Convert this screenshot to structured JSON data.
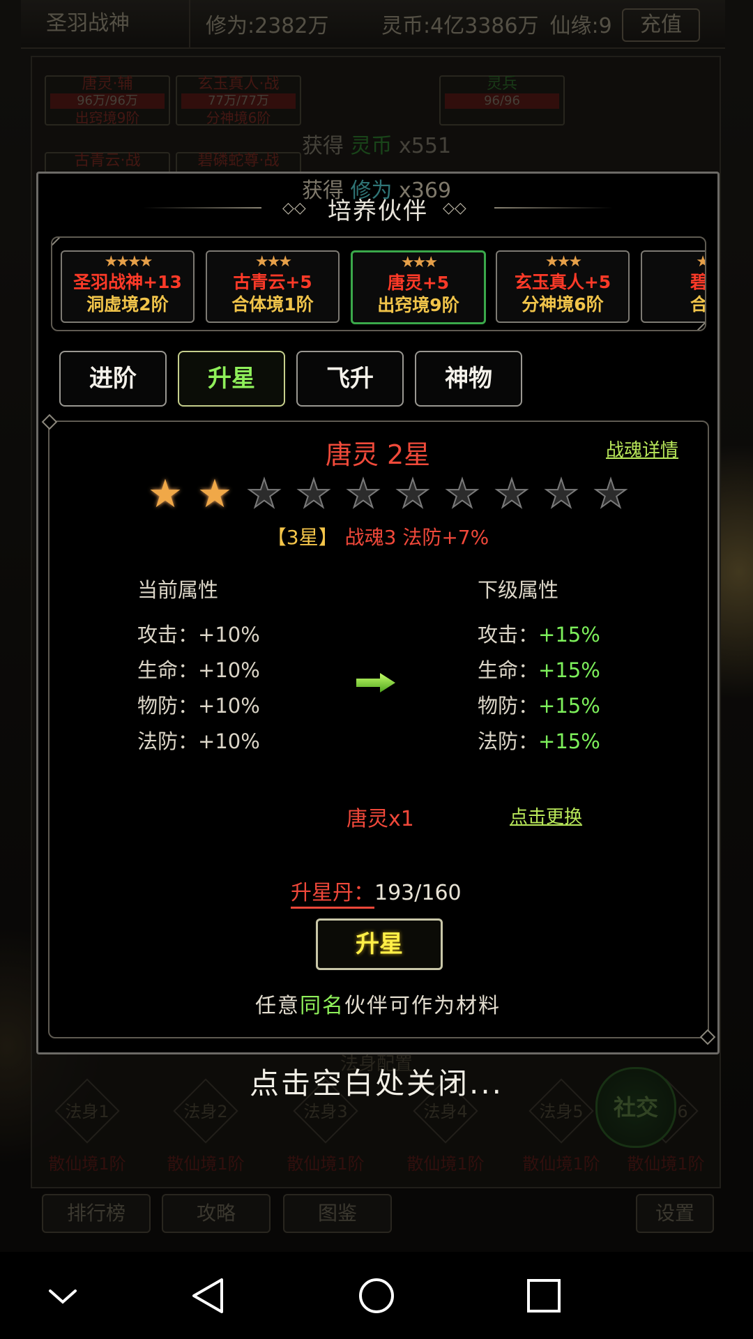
{
  "topbar": {
    "player_name": "圣羽战神",
    "cultivation": "修为:2382万",
    "spirit_coin": "灵币:4亿3386万",
    "fate": "仙缘:9",
    "recharge": "充值"
  },
  "background": {
    "cells": [
      {
        "title": "唐灵·辅",
        "hp": "96万/96万",
        "realm": "出窍境9阶"
      },
      {
        "title": "玄玉真人·战",
        "hp": "77万/77万",
        "realm": "分神境6阶"
      },
      {
        "title": "灵兵",
        "hp": "96/96",
        "realm": ""
      },
      {
        "title": "古青云·战",
        "hp": "",
        "realm": ""
      },
      {
        "title": "碧磷蛇尊·战",
        "hp": "",
        "realm": ""
      }
    ],
    "gain1": {
      "prefix": "获得 ",
      "item": "灵币",
      "qty": " x551"
    },
    "gain2": {
      "prefix": "获得 ",
      "item": "修为",
      "qty": " x369"
    },
    "fashen_title": "法身配置",
    "fashen": [
      {
        "name": "法身1",
        "realm": "散仙境1阶"
      },
      {
        "name": "法身2",
        "realm": "散仙境1阶"
      },
      {
        "name": "法身3",
        "realm": "散仙境1阶"
      },
      {
        "name": "法身4",
        "realm": "散仙境1阶"
      },
      {
        "name": "法身5",
        "realm": "散仙境1阶"
      },
      {
        "name": "法身6",
        "realm": "散仙境1阶"
      }
    ],
    "social": "社交",
    "bottom_buttons": [
      "排行榜",
      "攻略",
      "图鉴",
      "设置"
    ]
  },
  "modal": {
    "title": "培养伙伴",
    "partners": [
      {
        "stars": "★★★★",
        "name": "圣羽战神+13",
        "realm": "洞虚境2阶",
        "active": false
      },
      {
        "stars": "★★★",
        "name": "古青云+5",
        "realm": "合体境1阶",
        "active": false
      },
      {
        "stars": "★★★",
        "name": "唐灵+5",
        "realm": "出窍境9阶",
        "active": true
      },
      {
        "stars": "★★★",
        "name": "玄玉真人+5",
        "realm": "分神境6阶",
        "active": false
      },
      {
        "stars": "★★",
        "name": "碧磷",
        "realm": "合体",
        "active": false
      }
    ],
    "tabs": [
      "进阶",
      "升星",
      "飞升",
      "神物"
    ],
    "active_tab": "升星",
    "partner_title": "唐灵 2星",
    "soul_detail_link": "战魂详情",
    "star_rating": {
      "current": 2,
      "max": 10
    },
    "next_star": {
      "label": "【3星】",
      "bonus": "战魂3 法防+7%"
    },
    "current_attrs": {
      "header": "当前属性",
      "rows": [
        {
          "k": "攻击：",
          "v": "+10%"
        },
        {
          "k": "生命：",
          "v": "+10%"
        },
        {
          "k": "物防：",
          "v": "+10%"
        },
        {
          "k": "法防：",
          "v": "+10%"
        }
      ]
    },
    "next_attrs": {
      "header": "下级属性",
      "rows": [
        {
          "k": "攻击：",
          "v": "+15%"
        },
        {
          "k": "生命：",
          "v": "+15%"
        },
        {
          "k": "物防：",
          "v": "+15%"
        },
        {
          "k": "法防：",
          "v": "+15%"
        }
      ]
    },
    "material": "唐灵x1",
    "swap_link": "点击更换",
    "pill_label": "升星丹：",
    "pill_count": "193/160",
    "upstar_button": "升星",
    "hint_prefix": "任意",
    "hint_highlight": "同名",
    "hint_suffix": "伙伴可作为材料"
  },
  "close_tip": "点击空白处关闭...",
  "navbar": {
    "icons": [
      "chevron-down-icon",
      "back-icon",
      "home-icon",
      "recents-icon"
    ]
  },
  "colors": {
    "active_green": "#3aa84a",
    "red": "#f0483a",
    "gold": "#f4c54a",
    "lime": "#8ff05a"
  }
}
